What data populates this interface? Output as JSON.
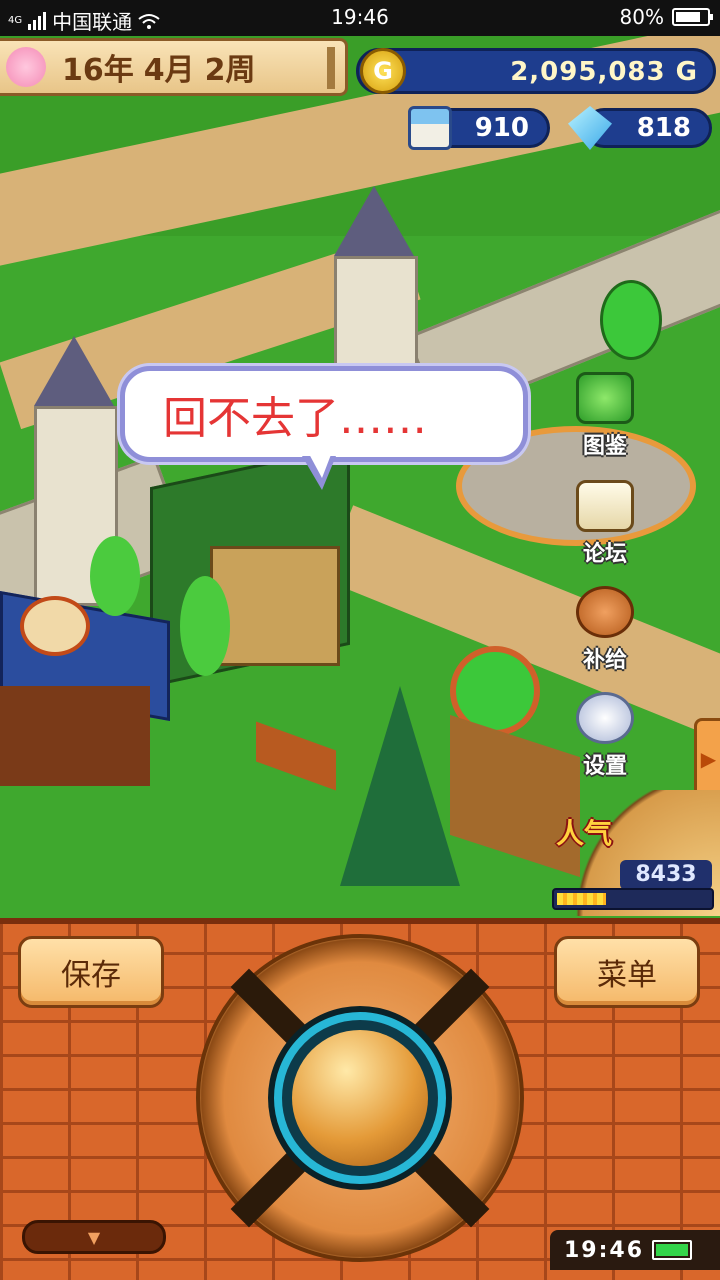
{
  "status_bar": {
    "network": "4G",
    "carrier": "中国联通",
    "time": "19:46",
    "battery_percent": "80%",
    "battery_level": 0.8
  },
  "hud": {
    "year": "16年",
    "month": "4月",
    "week": "2周",
    "gold": "2,095,083",
    "gold_unit": "G",
    "coin_symbol": "G",
    "residents": "910",
    "gems": "818"
  },
  "speech_bubble": {
    "text": "回不去了……"
  },
  "side_menu": {
    "encyclopedia": "图鉴",
    "forum": "论坛",
    "supply": "补给",
    "settings": "设置"
  },
  "popularity": {
    "label": "人气",
    "value": "8433",
    "bar_level": 0.32
  },
  "controls": {
    "save_label": "保存",
    "menu_label": "菜单",
    "pull_tab_icon": "chevron-down-icon"
  },
  "game_clock": {
    "time": "19:46",
    "battery_level": 1.0
  },
  "colors": {
    "grass": "#3fa82e",
    "panel_brick": "#d9672b",
    "hud_blue": "#1e3d8e",
    "bubble_text": "#e53535",
    "accent_cyan": "#27b7d6"
  }
}
